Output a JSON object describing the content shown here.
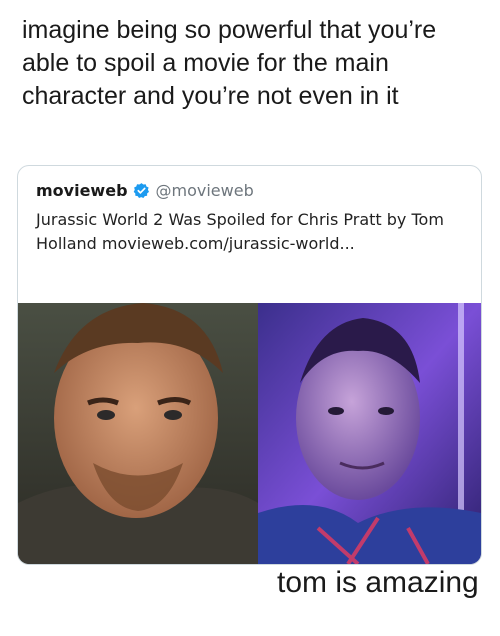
{
  "caption": "imagine being so powerful that you’re able to spoil a movie for the main character and you’re not even in it",
  "tweet": {
    "author_name": "movieweb",
    "handle": "@movieweb",
    "text": "Jurassic World 2 Was Spoiled for Chris Pratt by Tom Holland movieweb.com/jurassic-world...",
    "verified_icon": "verified-badge-icon",
    "accent_color": "#1d9bf0"
  },
  "footer": "tom is amazing"
}
